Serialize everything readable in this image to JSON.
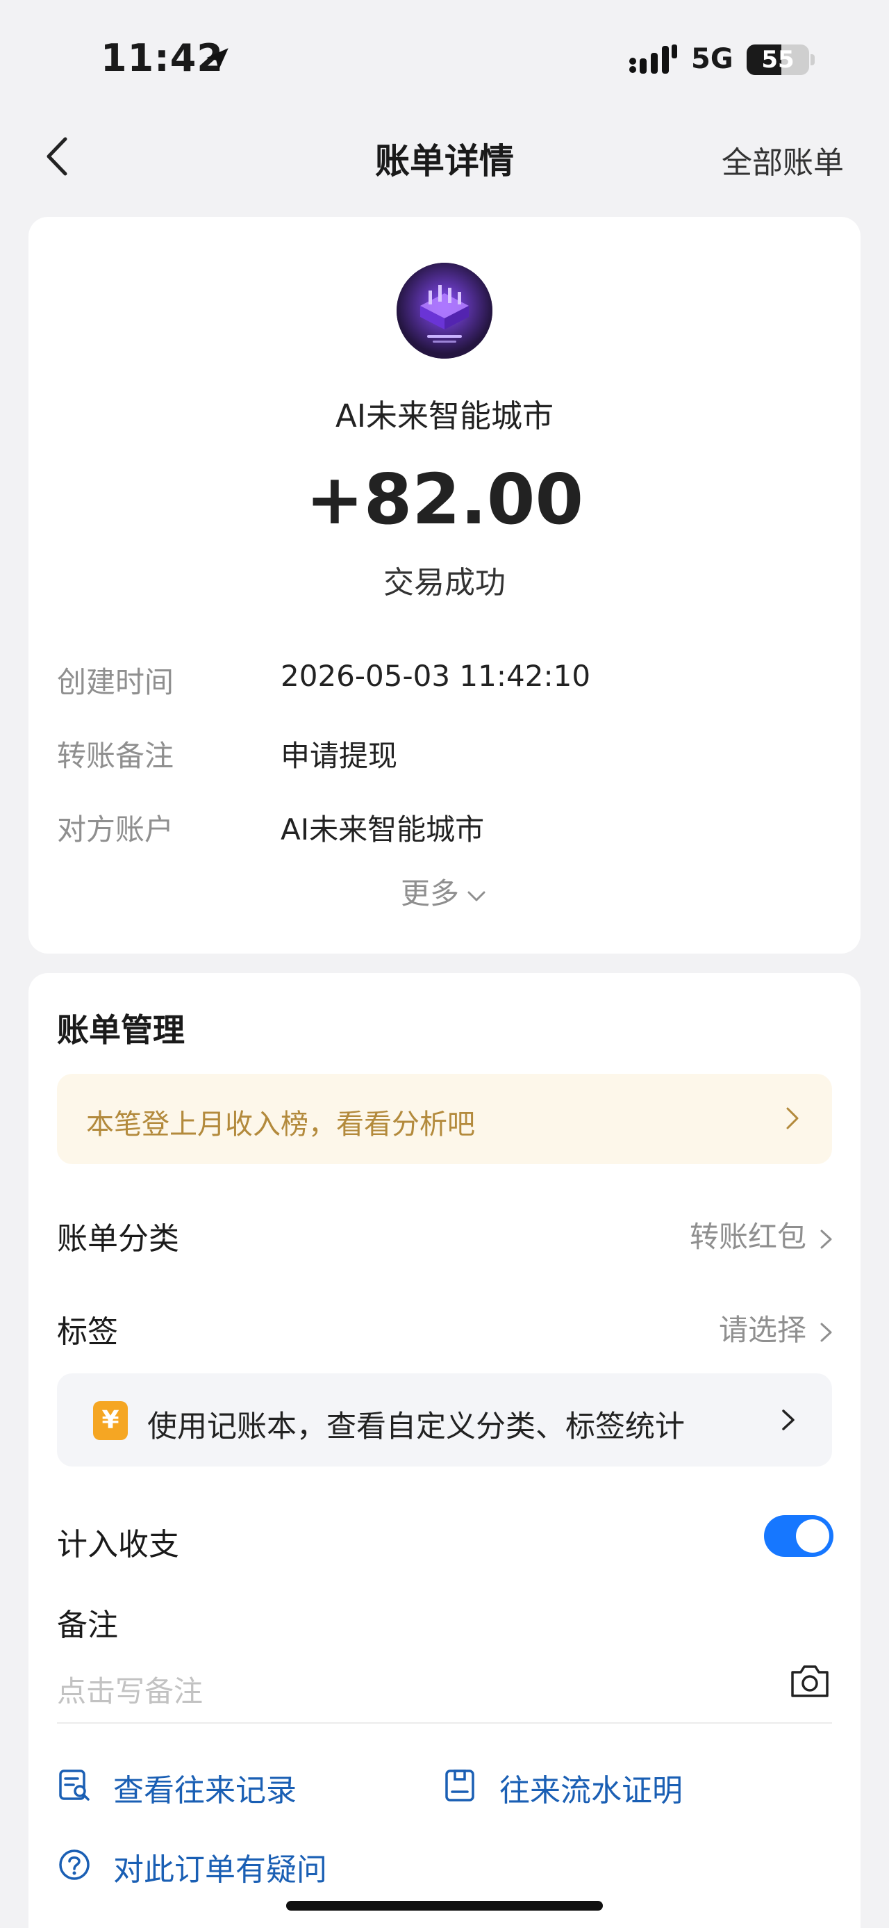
{
  "status_bar": {
    "time": "11:42",
    "network": "5G",
    "battery": "55",
    "battery_level": 0.55
  },
  "nav": {
    "title": "账单详情",
    "right_link": "全部账单"
  },
  "transaction": {
    "merchant": "AI未来智能城市",
    "amount": "+82.00",
    "status": "交易成功",
    "details": [
      {
        "label": "创建时间",
        "value": "2026-05-03 11:42:10"
      },
      {
        "label": "转账备注",
        "value": "申请提现"
      },
      {
        "label": "对方账户",
        "value": "AI未来智能城市"
      }
    ],
    "more_label": "更多"
  },
  "management": {
    "title": "账单管理",
    "banner": "本笔登上月收入榜，看看分析吧",
    "category": {
      "label": "账单分类",
      "value": "转账红包"
    },
    "tags": {
      "label": "标签",
      "value": "请选择"
    },
    "promo": {
      "icon_text": "¥",
      "text": "使用记账本，查看自定义分类、标签统计"
    },
    "include": {
      "label": "计入收支",
      "enabled": true
    },
    "note": {
      "label": "备注",
      "placeholder": "点击写备注"
    },
    "links": [
      {
        "label": "查看往来记录",
        "icon": "record-search-icon"
      },
      {
        "label": "往来流水证明",
        "icon": "statement-proof-icon"
      },
      {
        "label": "对此订单有疑问",
        "icon": "question-icon"
      }
    ]
  },
  "colors": {
    "accent": "#1677ff",
    "link": "#1a5fb4",
    "banner_text": "#b38a3c",
    "banner_bg": "#fdf7ea"
  }
}
